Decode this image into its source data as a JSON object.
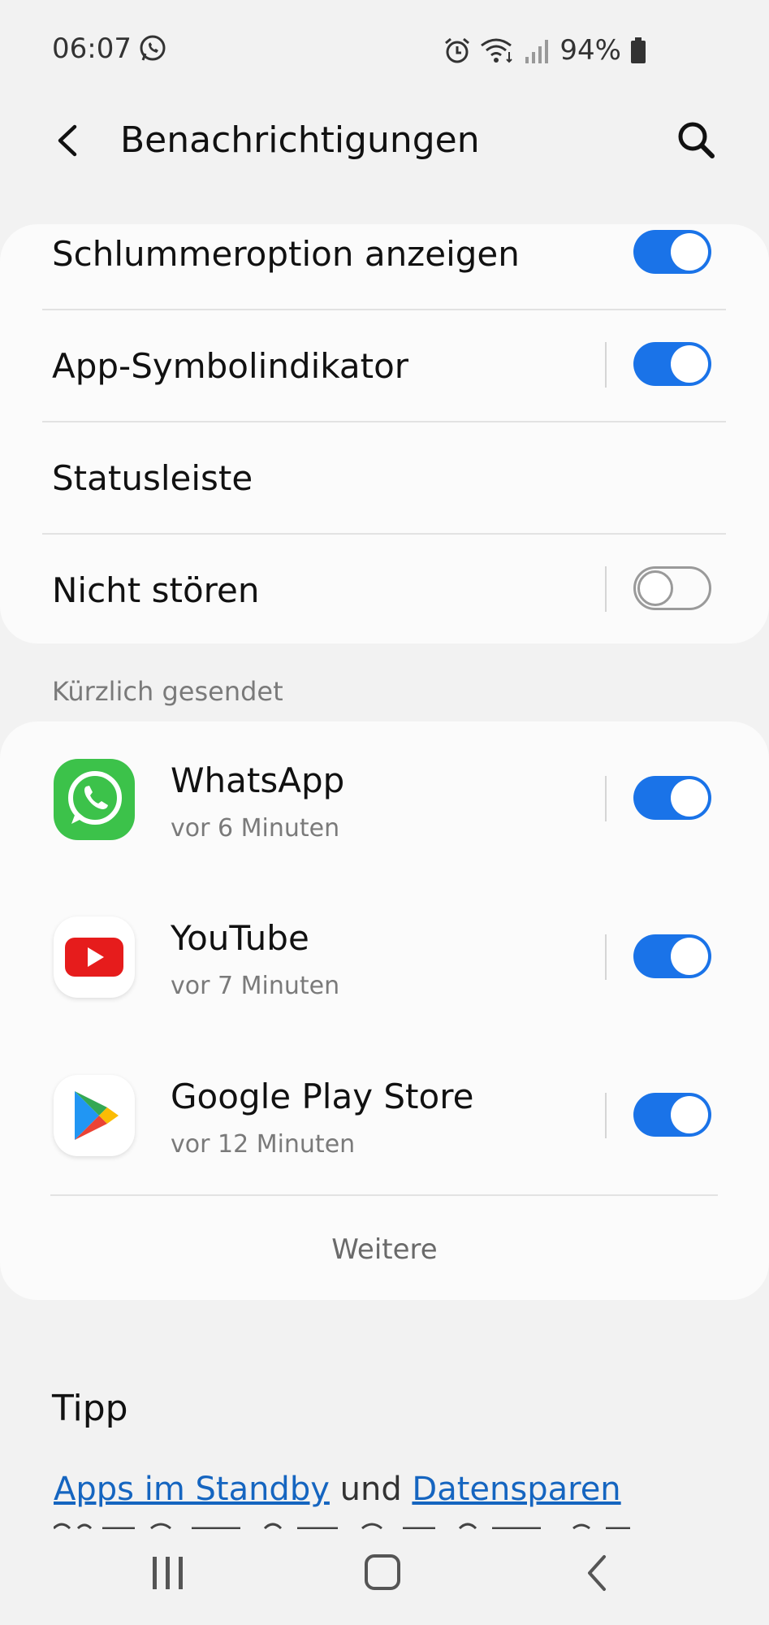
{
  "status_bar": {
    "time": "06:07",
    "battery_pct": "94%"
  },
  "header": {
    "title": "Benachrichtigungen"
  },
  "settings": [
    {
      "label": "Schlummeroption anzeigen",
      "toggle": true
    },
    {
      "label": "App-Symbolindikator",
      "toggle": true
    },
    {
      "label": "Statusleiste"
    },
    {
      "label": "Nicht stören",
      "toggle": false
    }
  ],
  "recent": {
    "section_label": "Kürzlich gesendet",
    "apps": [
      {
        "name": "WhatsApp",
        "sub": "vor 6 Minuten",
        "enabled": true,
        "icon": "whatsapp-icon"
      },
      {
        "name": "YouTube",
        "sub": "vor 7 Minuten",
        "enabled": true,
        "icon": "youtube-icon"
      },
      {
        "name": "Google Play Store",
        "sub": "vor 12 Minuten",
        "enabled": true,
        "icon": "play-store-icon"
      }
    ],
    "more_label": "Weitere"
  },
  "tip": {
    "title": "Tipp",
    "link1": "Apps im Standby",
    "conjunction": "und",
    "link2": "Datensparen"
  },
  "colors": {
    "accent": "#1a73e8",
    "background": "#f2f2f2",
    "card": "#fbfbfb"
  }
}
